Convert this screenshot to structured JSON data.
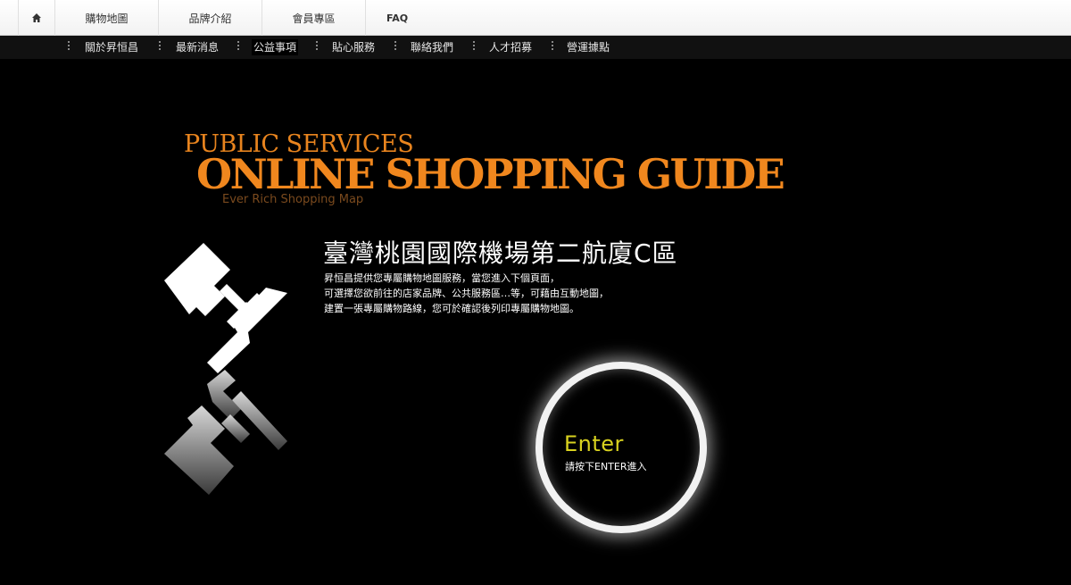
{
  "topnav": {
    "home_icon": "home-icon",
    "tabs": [
      "購物地圖",
      "品牌介紹",
      "會員專區",
      "FAQ"
    ]
  },
  "subnav": {
    "items": [
      "關於昇恒昌",
      "最新消息",
      "公益事項",
      "貼心服務",
      "聯絡我們",
      "人才招募",
      "營運據點"
    ],
    "active": "公益事項"
  },
  "hero": {
    "small_title": "PUBLIC SERVICES",
    "big_title": "ONLINE SHOPPING GUIDE",
    "subtitle": "Ever Rich Shopping Map",
    "terminal_title": "臺灣桃園國際機場第二航廈C區",
    "description": [
      "昇恒昌提供您專屬購物地圖服務，當您進入下個頁面，",
      "可選擇您欲前往的店家品牌、公共服務區…等，可藉由互動地圖，",
      "建置一張專屬購物路線，您可於確認後列印專屬購物地圖。"
    ]
  },
  "enter": {
    "label": "Enter",
    "hint": "請按下ENTER進入"
  },
  "colors": {
    "accent_orange": "#f0871e",
    "enter_yellow": "#d9d21f",
    "background": "#000000"
  }
}
